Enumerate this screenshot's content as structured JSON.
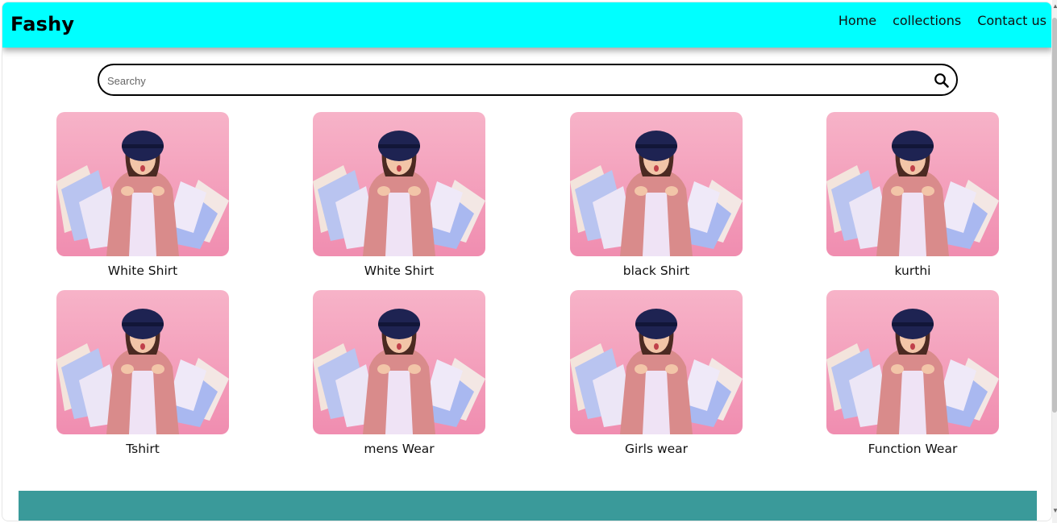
{
  "navbar": {
    "brand": "Fashy",
    "links": [
      {
        "label": "Home"
      },
      {
        "label": "collections"
      },
      {
        "label": "Contact us"
      }
    ],
    "background": "#00ffff"
  },
  "search": {
    "placeholder": "Searchy",
    "value": ""
  },
  "products": [
    {
      "label": "White Shirt"
    },
    {
      "label": "White Shirt"
    },
    {
      "label": "black Shirt"
    },
    {
      "label": "kurthi"
    },
    {
      "label": "Tshirt"
    },
    {
      "label": "mens Wear"
    },
    {
      "label": "Girls wear"
    },
    {
      "label": "Function Wear"
    }
  ],
  "footer": {
    "color": "#3a9a9a"
  }
}
